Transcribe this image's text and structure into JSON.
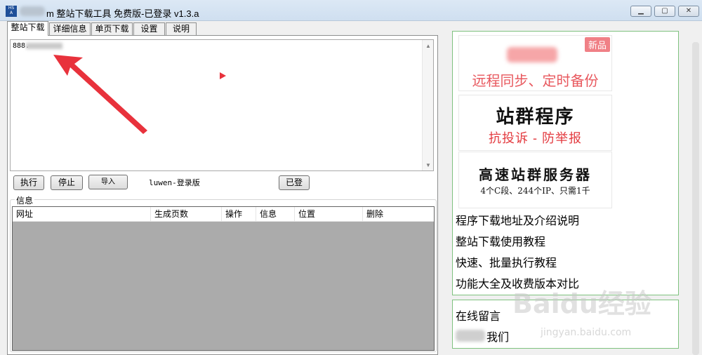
{
  "titlebar": {
    "title": "整站下载工具 免费版-已登录  v1.3.a",
    "title_suffix_visible": "m",
    "buttons": [
      "minimize",
      "maximize",
      "close"
    ]
  },
  "tabs": [
    {
      "label": "整站下载",
      "active": true
    },
    {
      "label": "详细信息",
      "active": false
    },
    {
      "label": "单页下载",
      "active": false
    },
    {
      "label": "设置",
      "active": false
    },
    {
      "label": "说明",
      "active": false
    }
  ],
  "url_input": {
    "value": "888."
  },
  "buttons": {
    "execute": "执行",
    "stop": "停止",
    "import": "导入",
    "logged_in": "已登"
  },
  "version_label": "luwen-登录版",
  "info_group": {
    "title": "信息",
    "columns": [
      "网址",
      "生成页数",
      "操作",
      "信息",
      "位置",
      "删除"
    ]
  },
  "ads": [
    {
      "badge": "新品",
      "subtitle": "远程同步、定时备份"
    },
    {
      "title": "站群程序",
      "subtitle": "抗投诉 - 防举报"
    },
    {
      "title": "高速站群服务器",
      "subtitle": "4个C段、244个IP、只需1千"
    }
  ],
  "links": [
    "程序下载地址及介绍说明",
    "整站下载使用教程",
    "快速、批量执行教程",
    "功能大全及收费版本对比"
  ],
  "contact": {
    "message": "在线留言",
    "contact_us_suffix": "我们"
  },
  "watermark": {
    "brand": "Baidu经验",
    "url": "jingyan.baidu.com"
  },
  "colors": {
    "arrow": "#e8323c",
    "panel_border": "#7fc27f"
  }
}
